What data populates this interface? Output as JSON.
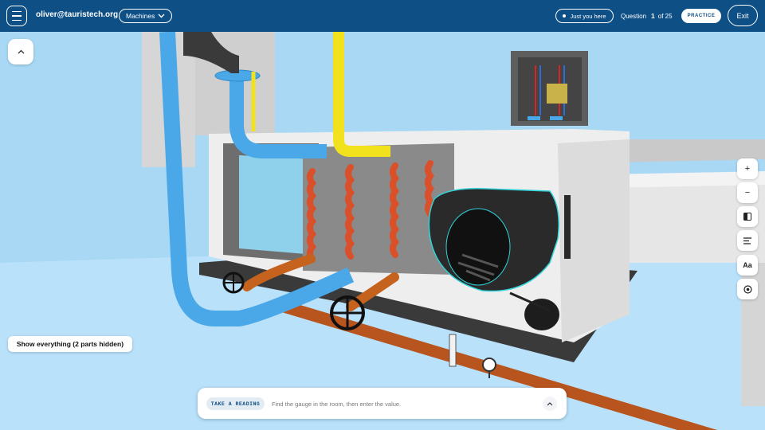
{
  "header": {
    "user_email": "oliver@tauristech.org",
    "machines_label": "Machines",
    "audience_label": "Just you here",
    "question_label": "Question",
    "question_number": "1",
    "question_total": "of 25",
    "practice_label": "PRACTICE",
    "exit_label": "Exit"
  },
  "icons": {
    "menu": "hamburger-icon",
    "machines_chevron": "chevron-down-icon",
    "collapse": "chevron-up-icon",
    "zoom_in": "plus-icon",
    "zoom_out": "minus-icon",
    "contrast": "contrast-icon",
    "align": "text-align-icon",
    "recenter": "target-icon"
  },
  "side_toolbar": {
    "zoom_in": "+",
    "zoom_out": "−",
    "text_size": "Aa"
  },
  "scene": {
    "show_everything_label": "Show everything (2 parts hidden)"
  },
  "task": {
    "badge": "TAKE A READING",
    "instruction": "Find the gauge in the room, then enter the value."
  },
  "colors": {
    "header_bg": "#0e4f86",
    "sky": "#a9d8f5",
    "floor": "#bfe4fa",
    "cold_pipe": "#4aa8e8",
    "hot_pipe": "#f2e21e",
    "copper": "#b8541e",
    "coil": "#d9502a",
    "highlight": "#2fd2d8"
  }
}
